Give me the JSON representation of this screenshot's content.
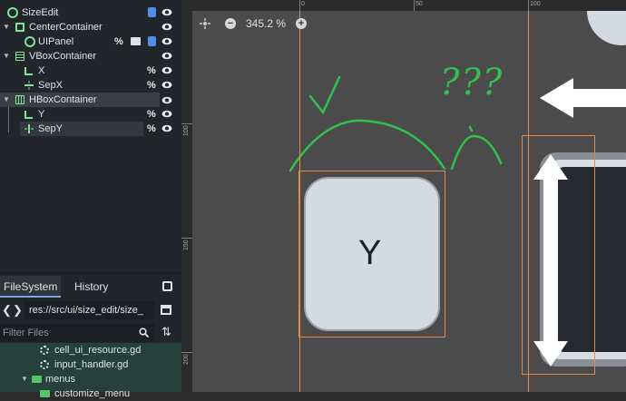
{
  "scene_tree": {
    "nodes": [
      {
        "label": "SizeEdit",
        "icon": "control-node-icon"
      },
      {
        "label": "CenterContainer",
        "icon": "center-container-icon"
      },
      {
        "label": "UIPanel",
        "icon": "control-node-icon"
      },
      {
        "label": "VBoxContainer",
        "icon": "vbox-container-icon"
      },
      {
        "label": "X",
        "icon": "label-icon"
      },
      {
        "label": "SepX",
        "icon": "hseparator-icon"
      },
      {
        "label": "HBoxContainer",
        "icon": "hbox-container-icon"
      },
      {
        "label": "Y",
        "icon": "label-icon"
      },
      {
        "label": "SepY",
        "icon": "vseparator-icon"
      }
    ],
    "badge_percent": "%"
  },
  "filesystem": {
    "tabs": [
      {
        "label": "FileSystem"
      },
      {
        "label": "History"
      }
    ],
    "path": "res://src/ui/size_edit/size_",
    "filter_placeholder": "Filter Files",
    "files": [
      {
        "label": "cell_ui_resource.gd",
        "icon": "gear-icon"
      },
      {
        "label": "input_handler.gd",
        "icon": "gear-icon"
      },
      {
        "label": "menus",
        "icon": "folder-icon"
      },
      {
        "label": "customize_menu",
        "icon": "folder-icon"
      }
    ]
  },
  "viewport": {
    "zoom": "345.2 %",
    "ruler_h": [
      "0",
      "50",
      "100"
    ],
    "ruler_v": [
      "100",
      "150",
      "200"
    ],
    "preview_label": "Y",
    "annotation_text": "???",
    "colors": {
      "guide": "#e38a4a",
      "annotation": "#31c04e",
      "panel": "#d3dae2"
    }
  }
}
